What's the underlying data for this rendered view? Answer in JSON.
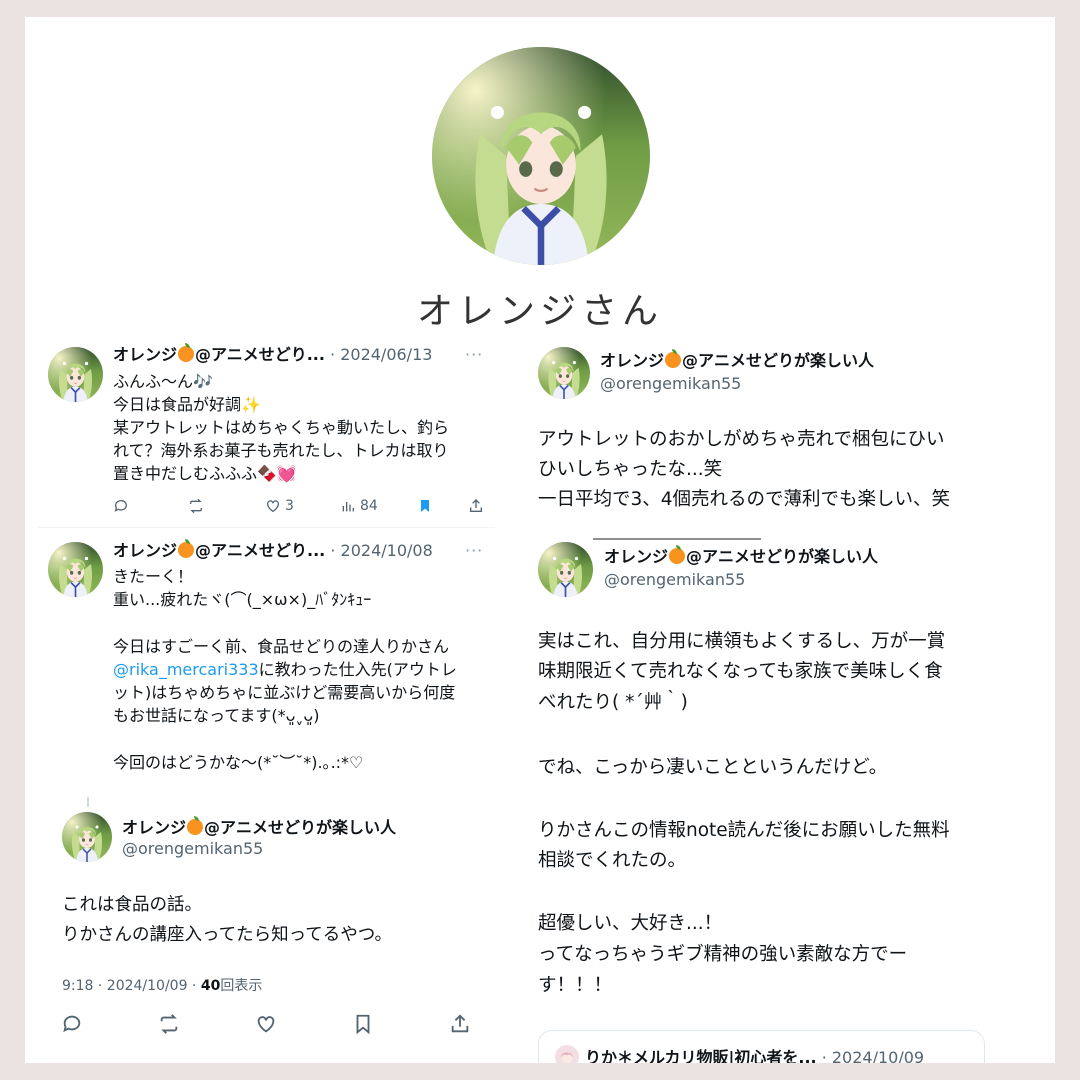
{
  "profile": {
    "display_name": "オレンジさん"
  },
  "tweet1": {
    "author": "オレンジ",
    "author_suffix": "@アニメせどり...",
    "date": "· 2024/06/13",
    "more": "···",
    "lines": [
      "ふんふ〜ん🎶",
      "今日は食品が好調✨",
      "某アウトレットはめちゃくちゃ動いたし、釣ら",
      "れて？海外系お菓子も売れたし、トレカは取り",
      "置き中だしむふふふ🍫💓"
    ],
    "actions": {
      "likes": "3",
      "views": "84"
    }
  },
  "tweet2": {
    "author": "オレンジ",
    "author_suffix": "@アニメせどり...",
    "date": "· 2024/10/08",
    "more": "···",
    "line1": "きたーく！",
    "line2": "重い...疲れたヾ(⌒(_×ω×)_ﾊﾞﾀﾝｷｭｰ",
    "line3": "今日はすごーく前、食品せどりの達人りかさん",
    "mention": "@rika_mercari333",
    "line4_rest": "に教わった仕入先(アウトレ",
    "line5": "ット)はちゃめちゃに並ぶけど需要高いから何度",
    "line6": "もお世話になってます(*ᴗ͈ˬᴗ͈)",
    "line7": "今回のはどうかな〜(*˘︶˘*).｡.:*♡"
  },
  "tweet3": {
    "author": "オレンジ",
    "author_suffix": "@アニメせどりが楽しい人",
    "handle": "@orengemikan55",
    "lines": [
      "これは食品の話。",
      "りかさんの講座入ってたら知ってるやつ。"
    ],
    "time": "9:18 · 2024/10/09 ·",
    "views_count": "40",
    "views_label": "回表示"
  },
  "tweet4": {
    "author": "オレンジ",
    "author_suffix": "@アニメせどりが楽しい人",
    "handle": "@orengemikan55",
    "lines": [
      "アウトレットのおかしがめちゃ売れで梱包にひい",
      "ひいしちゃったな...笑",
      "一日平均で3、4個売れるので薄利でも楽しい、笑"
    ]
  },
  "tweet5": {
    "author": "オレンジ",
    "author_suffix": "@アニメせどりが楽しい人",
    "handle": "@orengemikan55",
    "lines": [
      "実はこれ、自分用に横領もよくするし、万が一賞",
      "味期限近くて売れなくなっても家族で美味しく食",
      "べれたり( *´艸｀)",
      "",
      "でね、こっから凄いことというんだけど。",
      "",
      "りかさんこの情報note読んだ後にお願いした無料",
      "相談でくれたの。",
      "",
      "超優しい、大好き...！",
      "ってなっちゃうギブ精神の強い素敵な方でー",
      "す！！！"
    ]
  },
  "quote": {
    "author": "りか＊メルカリ物販|初心者を...",
    "date": "· 2024/10/09"
  },
  "colors": {
    "accent": "#1d9bf0",
    "bookmark": "#1d9bf0",
    "background": "#ebe2e2",
    "orange": "#f7931e"
  }
}
